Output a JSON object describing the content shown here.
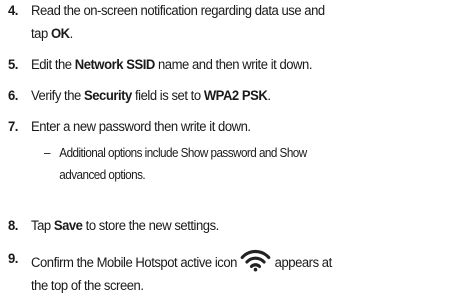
{
  "steps": [
    {
      "number": "4.",
      "line1_pre": "Read the on-screen notification regarding data use and",
      "line2_pre": "tap ",
      "line2_bold": "OK",
      "line2_post": "."
    },
    {
      "number": "5.",
      "pre": "Edit the ",
      "bold": "Network SSID",
      "post": " name and then write it down."
    },
    {
      "number": "6.",
      "pre": "Verify the ",
      "bold1": "Security",
      "mid": " field is set to ",
      "bold2": "WPA2 PSK",
      "post": "."
    },
    {
      "number": "7.",
      "text": "Enter a new password then write it down.",
      "sub_dash": "–",
      "sub_line1": "Additional options include Show password and Show",
      "sub_line2": "advanced options."
    },
    {
      "number": "8.",
      "pre": "Tap ",
      "bold": "Save",
      "post": " to store the new settings."
    },
    {
      "number": "9.",
      "line1_pre": "Confirm the Mobile Hotspot active icon",
      "line1_post": "appears at",
      "line2": "the top of the screen.",
      "icon": "wifi-hotspot-icon"
    }
  ]
}
